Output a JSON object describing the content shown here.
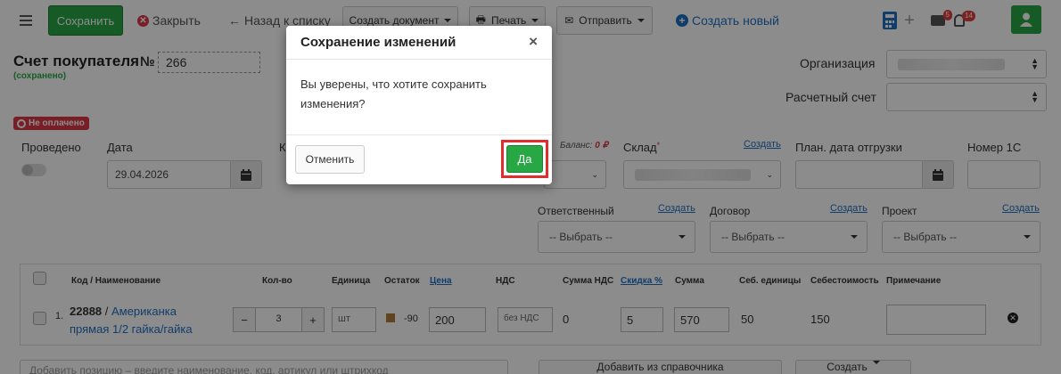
{
  "toolbar": {
    "save": "Сохранить",
    "close": "Закрыть",
    "back": "Назад к списку",
    "create_doc": "Создать документ",
    "print": "Печать",
    "send": "Отправить",
    "create_new": "Создать новый",
    "mail_badge": "5",
    "bell_badge": "14"
  },
  "header": {
    "title": "Счет покупателя",
    "number_label": "№",
    "number": "266",
    "status": "(сохранено)",
    "payment_status": "Не оплачено",
    "org_label": "Организация",
    "account_label": "Расчетный счет"
  },
  "form": {
    "posted_label": "Проведено",
    "date_label": "Дата",
    "date_value": "29.04.2026",
    "k_label": "К",
    "balance_label": "Баланс:",
    "balance_value": "0 ₽",
    "warehouse_label": "Склад",
    "warehouse_required": "*",
    "create_link": "Создать",
    "ship_date_label": "План. дата отгрузки",
    "num1c_label": "Номер 1С",
    "responsible_label": "Ответственный",
    "contract_label": "Договор",
    "project_label": "Проект",
    "choose": "-- Выбрать --"
  },
  "table": {
    "columns": [
      "Код / Наименование",
      "Кол-во",
      "Единица",
      "Остаток",
      "Цена",
      "НДС",
      "Сумма НДС",
      "Скидка %",
      "Сумма",
      "Себ. единицы",
      "Себестоимость",
      "Примечание"
    ],
    "row": {
      "index": "1.",
      "code": "22888",
      "sep": "/",
      "name_line1": "Американка",
      "name_line2": "прямая 1/2 гайка/гайка",
      "minus": "−",
      "qty": "3",
      "plus": "+",
      "unit": "шт",
      "stock": "-90",
      "price": "200",
      "vat": "без НДС",
      "vat_sum": "0",
      "discount": "5",
      "sum": "570",
      "cost_unit": "50",
      "cost_total": "150"
    }
  },
  "bottom": {
    "add_placeholder": "Добавить позицию – введите наименование, код, артикул или штрихкод",
    "add_from_ref": "Добавить из справочника",
    "create": "Создать"
  },
  "modal": {
    "title": "Сохранение изменений",
    "close": "×",
    "body": "Вы уверены, что хотите сохранить изменения?",
    "cancel": "Отменить",
    "confirm": "Да"
  }
}
